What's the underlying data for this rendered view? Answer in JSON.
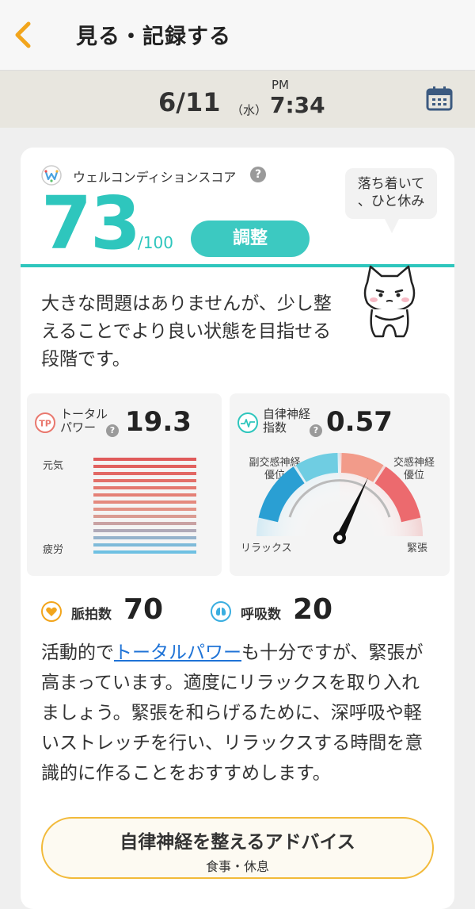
{
  "header": {
    "title": "見る・記録する"
  },
  "datebar": {
    "date": "6/11",
    "day_of_week": "（水）",
    "ampm": "PM",
    "time": "7:34"
  },
  "score": {
    "label": "ウェルコンディションスコア",
    "value": "73",
    "max": "/100",
    "status": "調整",
    "speech": [
      "落ち着いて",
      "、ひと休み"
    ],
    "summary": "大きな問題はありませんが、少し整えることでより良い状態を目指せる段階です。",
    "accent_color": "#2ec6bd"
  },
  "total_power": {
    "badge": "TP",
    "label_line1": "トータル",
    "label_line2": "パワー",
    "value": "19.3",
    "axis_top": "元気",
    "axis_bottom": "疲労"
  },
  "ans": {
    "label_line1": "自律神経",
    "label_line2": "指数",
    "value": "0.57",
    "para_line1": "副交感神経",
    "para_line2": "優位",
    "sym_line1": "交感神経",
    "sym_line2": "優位",
    "relax": "リラックス",
    "tension": "緊張"
  },
  "pulse": {
    "label": "脈拍数",
    "value": "70"
  },
  "breath": {
    "label": "呼吸数",
    "value": "20"
  },
  "advice": {
    "prefix": "活動的で",
    "link": "トータルパワー",
    "rest": "も十分ですが、緊張が高まっています。適度にリラックスを取り入れましょう。緊張を和らげるために、深呼吸や軽いストレッチを行い、リラックスする時間を意識的に作ることをおすすめします。"
  },
  "advice_button": {
    "title": "自律神経を整えるアドバイス",
    "subtitle": "食事・休息"
  },
  "icons": [
    "back-chevron-icon",
    "calendar-icon",
    "wellcondition-logo-icon",
    "help-icon",
    "cat-mascot",
    "tp-badge-icon",
    "heartbeat-icon",
    "heart-icon",
    "lungs-icon"
  ]
}
